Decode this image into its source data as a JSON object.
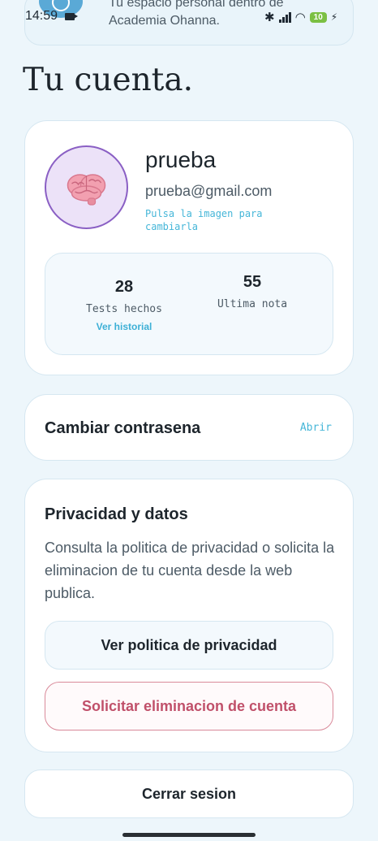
{
  "status_bar": {
    "time": "14:59",
    "battery": "10"
  },
  "header": {
    "line1": "Tu espacio personal dentro de",
    "line2": "Academia Ohanna."
  },
  "page": {
    "title": "Tu cuenta."
  },
  "profile": {
    "name": "prueba",
    "email": "prueba@gmail.com",
    "avatar_hint": "Pulsa la imagen para cambiarla",
    "avatar_icon": "brain-icon",
    "stats": {
      "tests_value": "28",
      "tests_label": "Tests hechos",
      "history_link": "Ver historial",
      "grade_value": "55",
      "grade_label": "Ultima nota"
    }
  },
  "password": {
    "title": "Cambiar contrasena",
    "action": "Abrir"
  },
  "privacy": {
    "title": "Privacidad y datos",
    "description": "Consulta la politica de privacidad o solicita la eliminacion de tu cuenta desde la web publica.",
    "view_policy_label": "Ver politica de privacidad",
    "delete_account_label": "Solicitar eliminacion de cuenta"
  },
  "logout": {
    "label": "Cerrar sesion"
  },
  "colors": {
    "accent": "#45b6d8",
    "avatar_border": "#8a5fc4",
    "danger": "#c0506a",
    "background": "#edf6fb"
  }
}
